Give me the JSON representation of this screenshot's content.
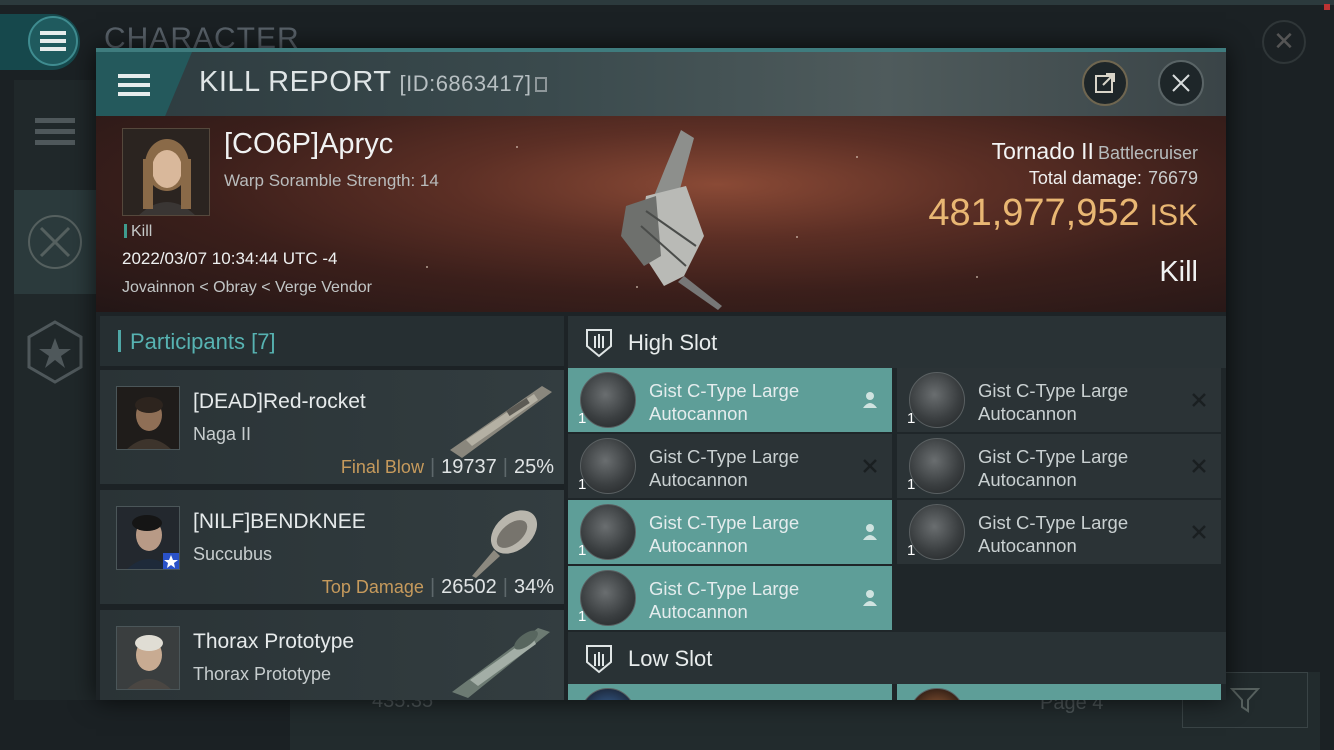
{
  "background_app": {
    "title": "CHARACTER",
    "bottom_value": "435.35",
    "pagination": "Page 4"
  },
  "kill_report": {
    "title": "KILL REPORT",
    "id": "[ID:6863417]",
    "victim": {
      "name": "[CO6P]Apryc",
      "subtitle": "Warp Soramble Strength: 14",
      "tag": "Kill",
      "datetime": "2022/03/07 10:34:44 UTC -4",
      "location": "Jovainnon < Obray < Verge Vendor"
    },
    "ship": {
      "name": "Tornado II",
      "class": "Battlecruiser",
      "total_damage_label": "Total damage:",
      "total_damage": "76679",
      "isk_value": "481,977,952",
      "isk_unit": "ISK",
      "result": "Kill"
    },
    "participants": {
      "header": "Participants",
      "count": "[7]",
      "rows": [
        {
          "name": "[DEAD]Red-rocket",
          "ship": "Naga II",
          "label": "Final Blow",
          "damage": "19737",
          "percent": "25%"
        },
        {
          "name": "[NILF]BENDKNEE",
          "ship": "Succubus",
          "label": "Top Damage",
          "damage": "26502",
          "percent": "34%"
        },
        {
          "name": "Thorax Prototype",
          "ship": "Thorax Prototype",
          "label": "",
          "damage": "",
          "percent": ""
        }
      ]
    },
    "fitting": {
      "high_slot_label": "High Slot",
      "low_slot_label": "Low Slot",
      "high_slot_items": [
        {
          "qty": "1",
          "line1": "Gist C-Type Large",
          "line2": "Autocannon",
          "state": "dropped"
        },
        {
          "qty": "1",
          "line1": "Gist C-Type Large",
          "line2": "Autocannon",
          "state": "destroyed"
        },
        {
          "qty": "1",
          "line1": "Gist C-Type Large",
          "line2": "Autocannon",
          "state": "destroyed"
        },
        {
          "qty": "1",
          "line1": "Gist C-Type Large",
          "line2": "Autocannon",
          "state": "destroyed"
        },
        {
          "qty": "1",
          "line1": "Gist C-Type Large",
          "line2": "Autocannon",
          "state": "dropped"
        },
        {
          "qty": "1",
          "line1": "Gist C-Type Large",
          "line2": "Autocannon",
          "state": "destroyed"
        },
        {
          "qty": "1",
          "line1": "Gist C-Type Large",
          "line2": "Autocannon",
          "state": "dropped"
        }
      ]
    }
  },
  "colors": {
    "accent_teal": "#5e9e98",
    "isk_gold": "#e9b773",
    "label_gold": "#c69a5c"
  }
}
